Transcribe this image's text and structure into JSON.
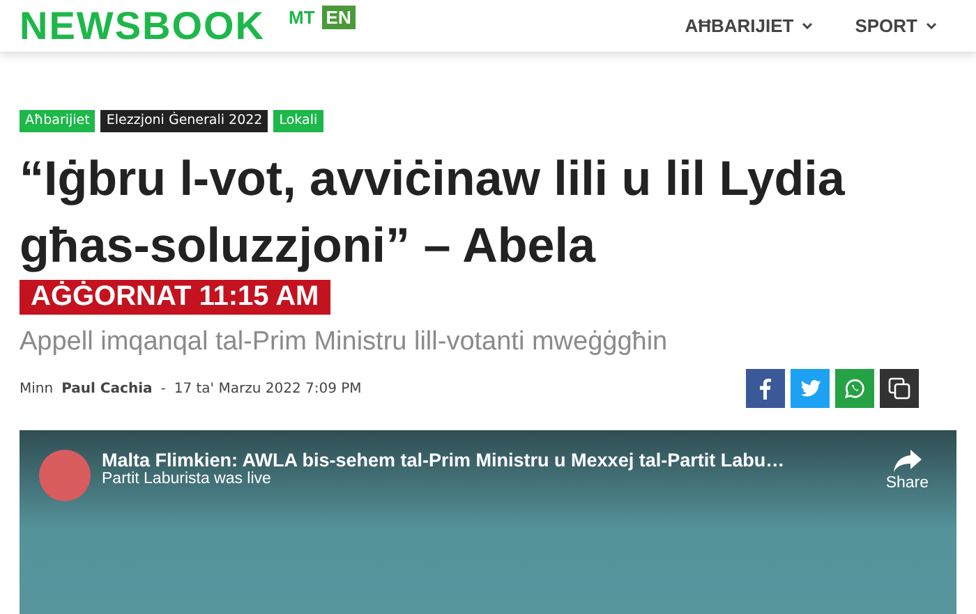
{
  "header": {
    "logo": "NEWSBOOK",
    "languages": [
      {
        "label": "MT",
        "selected": false
      },
      {
        "label": "EN",
        "selected": true
      }
    ],
    "nav": [
      {
        "label": "AĦBARIJIET"
      },
      {
        "label": "SPORT"
      }
    ]
  },
  "article": {
    "tags": [
      {
        "label": "Aħbarijiet",
        "color": "#1db74a"
      },
      {
        "label": "Elezzjoni Ġenerali 2022",
        "color": "#222222"
      },
      {
        "label": "Lokali",
        "color": "#1db74a"
      }
    ],
    "title": "“Iġbru l-vot, avviċinaw lili u lil Lydia għas-soluzzjoni” – Abela",
    "update_badge": "AĠĠORNAT 11:15 AM",
    "subtitle": "Appell imqanqal tal-Prim Ministru lill-votanti mweġġgħin",
    "byline": {
      "prefix": "Minn",
      "author": "Paul Cachia",
      "separator": "-",
      "date": "17 ta' Marzu 2022 7:09 PM"
    },
    "share_buttons": [
      {
        "kind": "facebook",
        "color": "#3b5998"
      },
      {
        "kind": "twitter",
        "color": "#1da1f2"
      },
      {
        "kind": "whatsapp",
        "color": "#25a244"
      },
      {
        "kind": "copy",
        "color": "#333333"
      }
    ]
  },
  "video": {
    "title": "Malta Flimkien: AWLA bis-sehem tal-Prim Ministru u Mexxej tal-Partit Labu…",
    "subtitle": "Partit Laburista was live",
    "share_label": "Share"
  }
}
